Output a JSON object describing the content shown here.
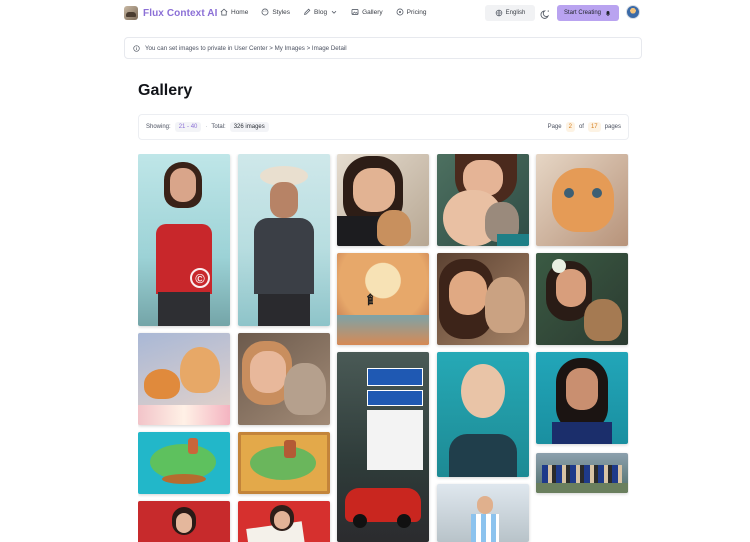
{
  "header": {
    "brand": "Flux Context AI",
    "nav": [
      {
        "label": "Home",
        "icon": "home-icon"
      },
      {
        "label": "Styles",
        "icon": "palette-icon"
      },
      {
        "label": "Blog",
        "icon": "pen-icon",
        "has_dropdown": true
      },
      {
        "label": "Gallery",
        "icon": "image-icon"
      },
      {
        "label": "Pricing",
        "icon": "tag-icon"
      }
    ],
    "language": "English",
    "cta": "Start Creating",
    "accent": "#b9a3f0",
    "brand_color": "#8b6fd6"
  },
  "notice": {
    "text": "You can set images to private in User Center > My Images > Image Detail"
  },
  "page": {
    "title": "Gallery"
  },
  "stats": {
    "showing_label": "Showing:",
    "showing_range": "21 - 40",
    "total_label": "Total:",
    "total_value": "326 images",
    "page_label": "Page",
    "current_page": "2",
    "of_label": "of",
    "total_pages": "17",
    "pages_label": "pages"
  },
  "gallery": {
    "images": [
      {
        "name": "woman-red-top-portrait",
        "watermark": true
      },
      {
        "name": "man-cowboy-hat-portrait"
      },
      {
        "name": "woman-with-kitten"
      },
      {
        "name": "woman-hugging-kitten"
      },
      {
        "name": "orange-kitten-closeup"
      },
      {
        "name": "moon-calligraphy-art"
      },
      {
        "name": "woman-cuddling-cat"
      },
      {
        "name": "woman-flower-hair-cat"
      },
      {
        "name": "kittens-on-flowers"
      },
      {
        "name": "woman-smiling-with-cat"
      },
      {
        "name": "road-sign-le-mans-race-car"
      },
      {
        "name": "bald-man-portrait"
      },
      {
        "name": "woman-blue-background-portrait"
      },
      {
        "name": "group-photo-outdoors"
      },
      {
        "name": "island-illustration-1"
      },
      {
        "name": "island-illustration-2"
      },
      {
        "name": "woman-red-background-1"
      },
      {
        "name": "woman-holding-paper"
      },
      {
        "name": "boy-soccer-jersey"
      }
    ]
  }
}
